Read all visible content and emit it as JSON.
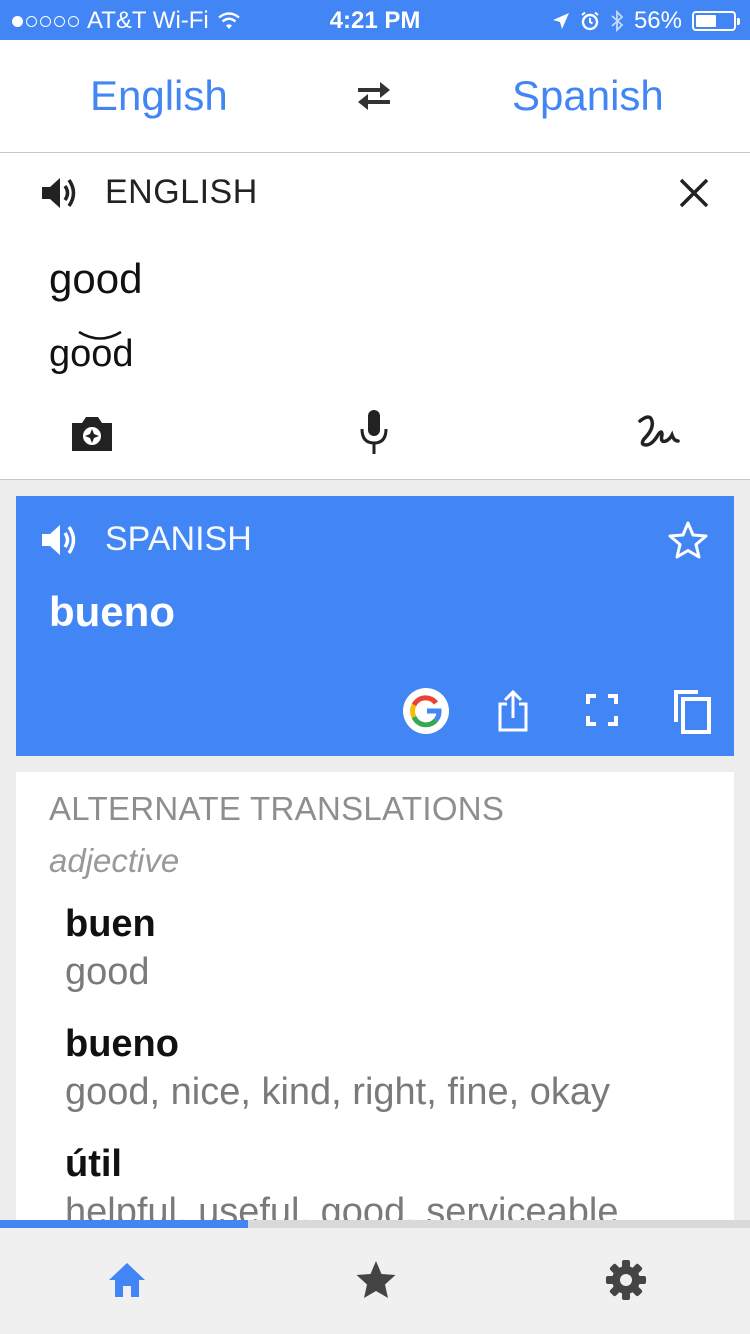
{
  "status_bar": {
    "carrier": "AT&T Wi-Fi",
    "time": "4:21 PM",
    "battery": "56%",
    "battery_level": 0.56,
    "signal_bars": 1
  },
  "language_bar": {
    "source_language": "English",
    "target_language": "Spanish"
  },
  "input": {
    "language_label": "ENGLISH",
    "text": "good",
    "transliteration": "good"
  },
  "translation": {
    "language_label": "SPANISH",
    "text": "bueno"
  },
  "alternates": {
    "title": "ALTERNATE TRANSLATIONS",
    "part_of_speech": "adjective",
    "entries": [
      {
        "word": "buen",
        "meanings": "good"
      },
      {
        "word": "bueno",
        "meanings": "good, nice, kind, right, fine, okay"
      },
      {
        "word": "útil",
        "meanings": "helpful, useful, good, serviceable"
      }
    ]
  },
  "loading_progress": 0.33,
  "colors": {
    "accent": "#4285f4",
    "google_red": "#ea4335",
    "google_yellow": "#fbbc05",
    "google_green": "#34a853"
  },
  "icons": {
    "status": [
      "wifi-icon",
      "location-arrow-icon",
      "alarm-icon",
      "bluetooth-icon",
      "battery-icon"
    ],
    "toolbar": [
      "camera-icon",
      "microphone-icon",
      "handwriting-icon"
    ],
    "translation_actions": [
      "google-icon",
      "share-icon",
      "fullscreen-icon",
      "copy-icon"
    ],
    "tabs": [
      "home-icon",
      "star-icon",
      "gear-icon"
    ]
  }
}
